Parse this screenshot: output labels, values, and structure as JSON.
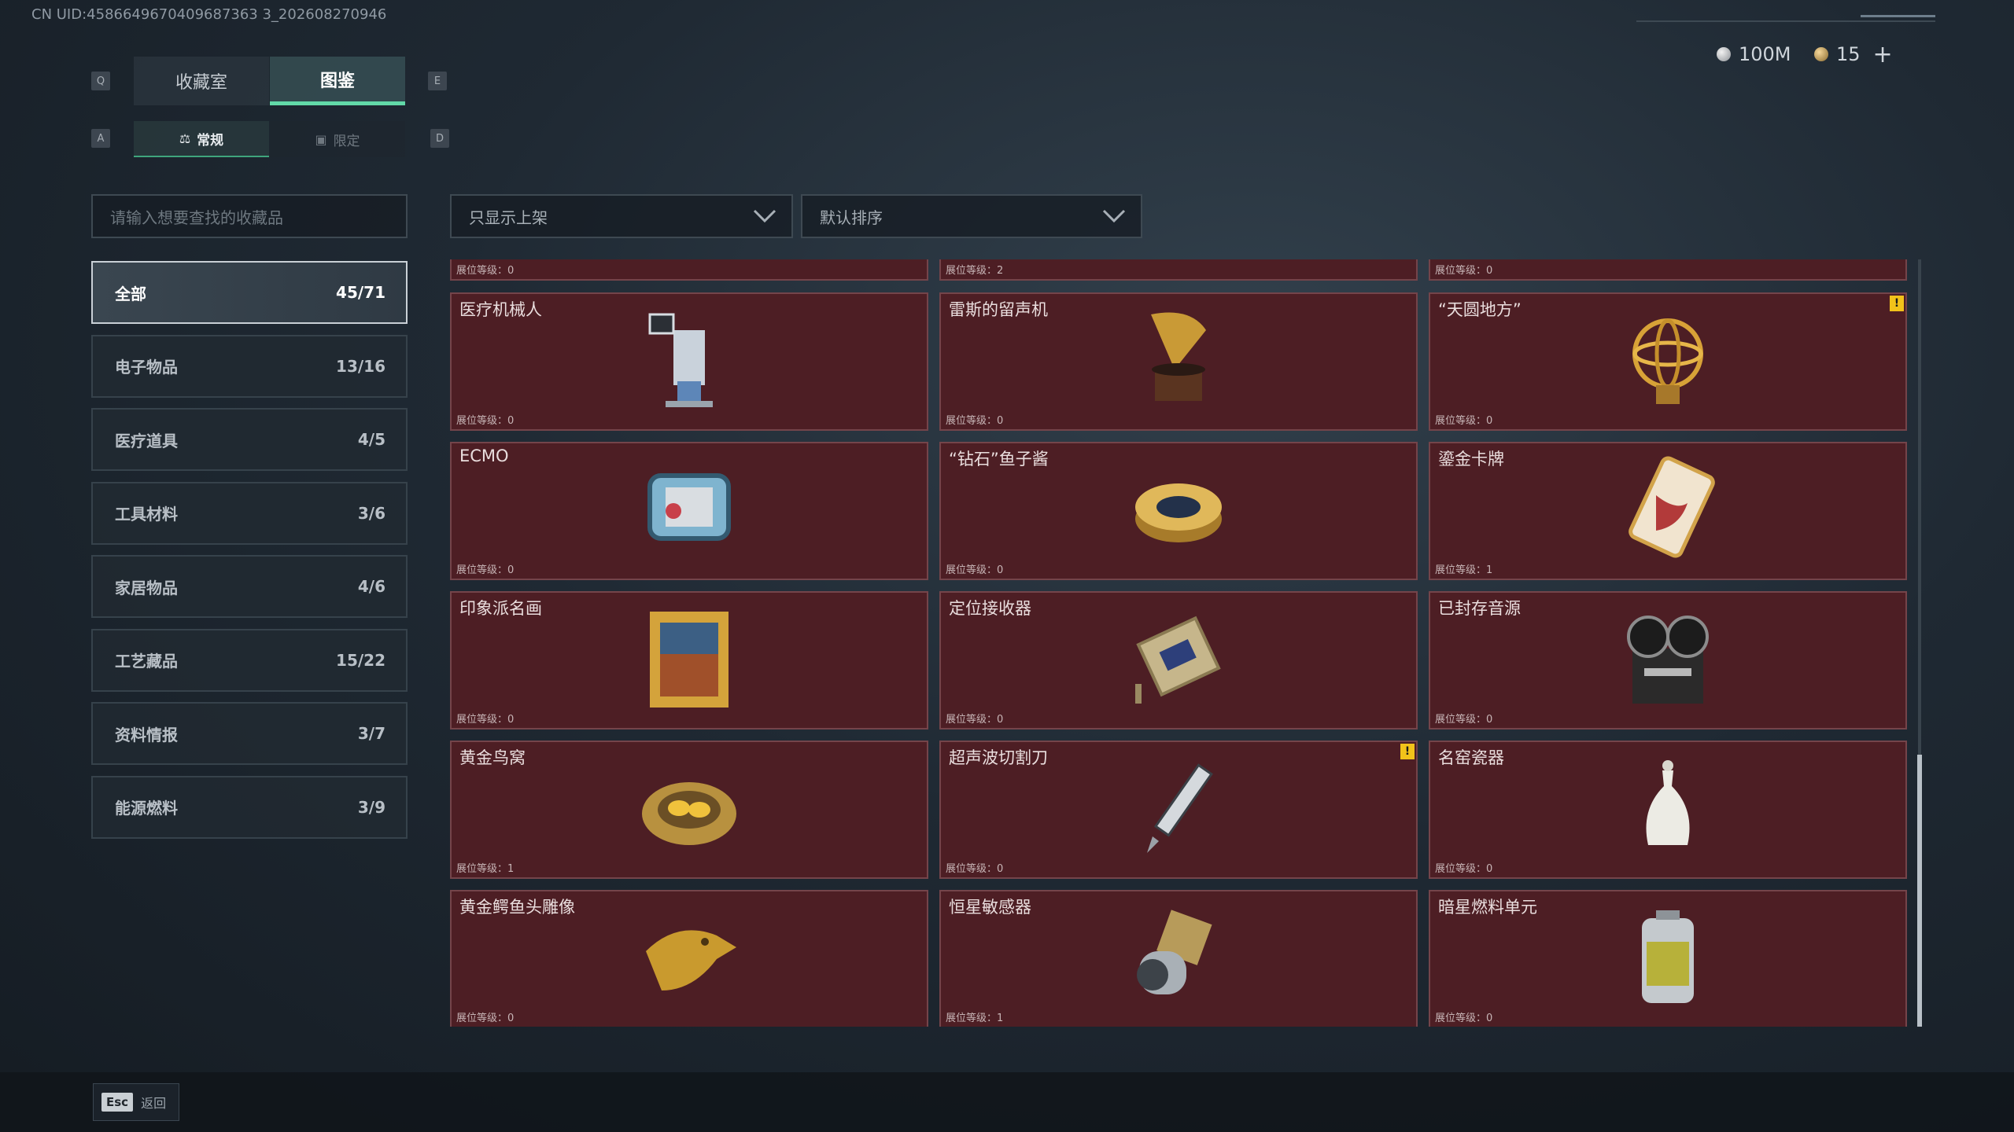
{
  "header": {
    "uid": "CN UID:4586649670409687363 3_202608270946",
    "silver_amount": "100M",
    "gold_amount": "15",
    "plus_label": "+"
  },
  "tabs": {
    "prev_key": "Q",
    "next_key": "E",
    "items": [
      {
        "label": "收藏室"
      },
      {
        "label": "图鉴"
      }
    ],
    "active": 1
  },
  "subtabs": {
    "prev_key": "A",
    "next_key": "D",
    "items": [
      {
        "label": "常规"
      },
      {
        "label": "限定"
      }
    ],
    "active": 0
  },
  "search": {
    "placeholder": "请输入想要查找的收藏品"
  },
  "filters": {
    "shelf_filter": "只显示上架",
    "sort": "默认排序"
  },
  "categories": [
    {
      "label": "全部",
      "count": "45/71",
      "active": true
    },
    {
      "label": "电子物品",
      "count": "13/16"
    },
    {
      "label": "医疗道具",
      "count": "4/5"
    },
    {
      "label": "工具材料",
      "count": "3/6"
    },
    {
      "label": "家居物品",
      "count": "4/6"
    },
    {
      "label": "工艺藏品",
      "count": "15/22"
    },
    {
      "label": "资料情报",
      "count": "3/7"
    },
    {
      "label": "能源燃料",
      "count": "3/9"
    }
  ],
  "level_label": "展位等级：",
  "partial_row": [
    {
      "level": "0"
    },
    {
      "level": "2"
    },
    {
      "level": "0"
    }
  ],
  "items": [
    {
      "name": "医疗机械人",
      "level": "0",
      "icon": "medical-robot-icon"
    },
    {
      "name": "雷斯的留声机",
      "level": "0",
      "icon": "gramophone-icon"
    },
    {
      "name": "“天圆地方”",
      "level": "0",
      "icon": "armillary-sphere-icon",
      "warning": true
    },
    {
      "name": "ECMO",
      "level": "0",
      "icon": "ecmo-machine-icon"
    },
    {
      "name": "“钻石”鱼子酱",
      "level": "0",
      "icon": "caviar-tin-icon"
    },
    {
      "name": "鎏金卡牌",
      "level": "1",
      "icon": "gilded-card-icon"
    },
    {
      "name": "印象派名画",
      "level": "0",
      "icon": "framed-painting-icon"
    },
    {
      "name": "定位接收器",
      "level": "0",
      "icon": "gps-receiver-icon"
    },
    {
      "name": "已封存音源",
      "level": "0",
      "icon": "reel-recorder-icon"
    },
    {
      "name": "黄金鸟窝",
      "level": "1",
      "icon": "golden-nest-icon"
    },
    {
      "name": "超声波切割刀",
      "level": "0",
      "icon": "ultrasonic-cutter-icon",
      "warning": true
    },
    {
      "name": "名窑瓷器",
      "level": "0",
      "icon": "porcelain-vase-icon"
    },
    {
      "name": "黄金鳄鱼头雕像",
      "level": "0",
      "icon": "golden-crocodile-icon"
    },
    {
      "name": "恒星敏感器",
      "level": "1",
      "icon": "star-sensor-icon"
    },
    {
      "name": "暗星燃料单元",
      "level": "0",
      "icon": "fuel-cell-icon"
    }
  ],
  "warning_glyph": "!",
  "footer": {
    "esc_key": "Esc",
    "back_label": "返回"
  }
}
